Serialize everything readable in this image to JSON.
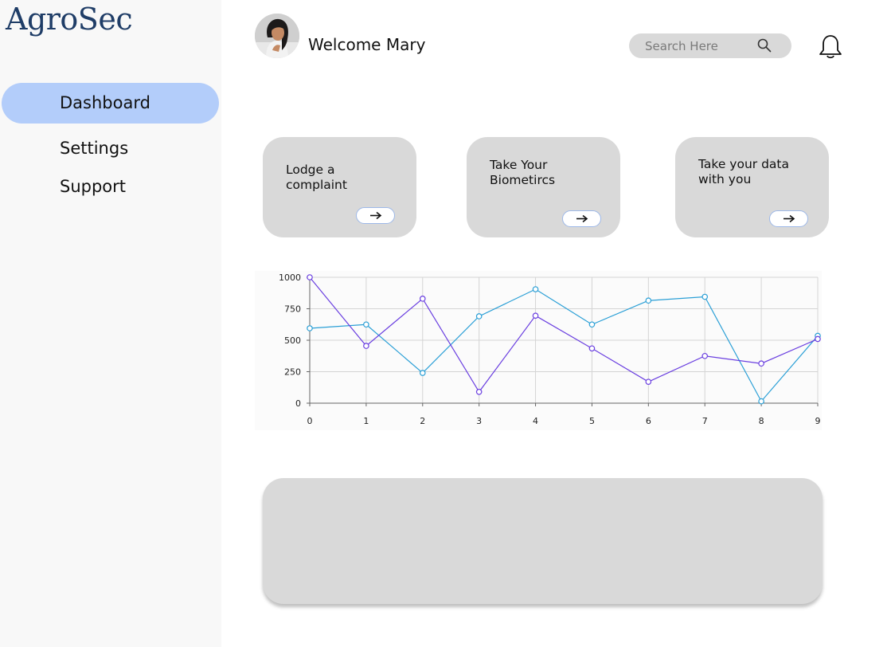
{
  "app": {
    "logo": "AgroSec"
  },
  "sidebar": {
    "items": [
      {
        "label": "Dashboard",
        "active": true
      },
      {
        "label": "Settings",
        "active": false
      },
      {
        "label": "Support",
        "active": false
      }
    ]
  },
  "header": {
    "welcome": "Welcome Mary",
    "search_placeholder": "Search Here",
    "icons": [
      "search-icon",
      "bell-icon"
    ]
  },
  "cards": [
    {
      "label": "Lodge a complaint",
      "button_icon": "arrow-right-icon"
    },
    {
      "label": "Take Your Biometircs",
      "button_icon": "arrow-right-icon"
    },
    {
      "label": "Take your data with you",
      "button_icon": "arrow-right-icon"
    }
  ],
  "chart_data": {
    "type": "line",
    "x": [
      0,
      1,
      2,
      3,
      4,
      5,
      6,
      7,
      8,
      9
    ],
    "series": [
      {
        "color": "#2a9fd6",
        "values": [
          595,
          625,
          240,
          690,
          905,
          625,
          815,
          845,
          15,
          535
        ]
      },
      {
        "color": "#6a3fe0",
        "values": [
          1000,
          455,
          830,
          90,
          695,
          435,
          170,
          375,
          315,
          510
        ]
      }
    ],
    "yticks": [
      0,
      250,
      500,
      750,
      1000
    ],
    "ylim": [
      0,
      1000
    ],
    "grid": true,
    "legend": "none"
  }
}
